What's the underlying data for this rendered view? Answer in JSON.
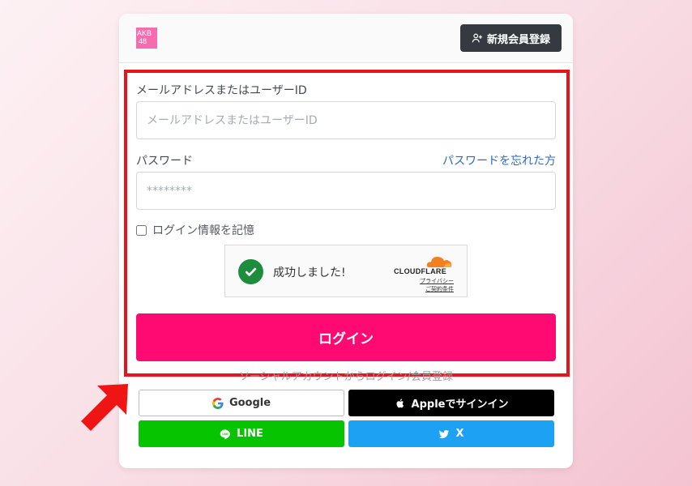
{
  "header": {
    "logo_line1": "AKB",
    "logo_line2": "48",
    "register_label": "新規会員登録",
    "register_icon": "user-plus-icon"
  },
  "form": {
    "email_label": "メールアドレスまたはユーザーID",
    "email_placeholder": "メールアドレスまたはユーザーID",
    "password_label": "パスワード",
    "forgot_link": "パスワードを忘れた方",
    "password_placeholder": "********",
    "remember_label": "ログイン情報を記憶",
    "login_label": "ログイン"
  },
  "turnstile": {
    "status": "成功しました!",
    "brand": "CLOUDFLARE",
    "privacy": "プライバシー",
    "terms": "ご契約条件"
  },
  "social": {
    "caption": "ソーシャルアカウントからログイン/会員登録",
    "google_label": "Google",
    "apple_label": "Appleでサインイン",
    "line_label": "LINE",
    "x_label": "X"
  },
  "colors": {
    "accent": "#ff0a72",
    "highlight_frame": "#e8141c",
    "line_green": "#06c400",
    "x_blue": "#1da1f2"
  }
}
